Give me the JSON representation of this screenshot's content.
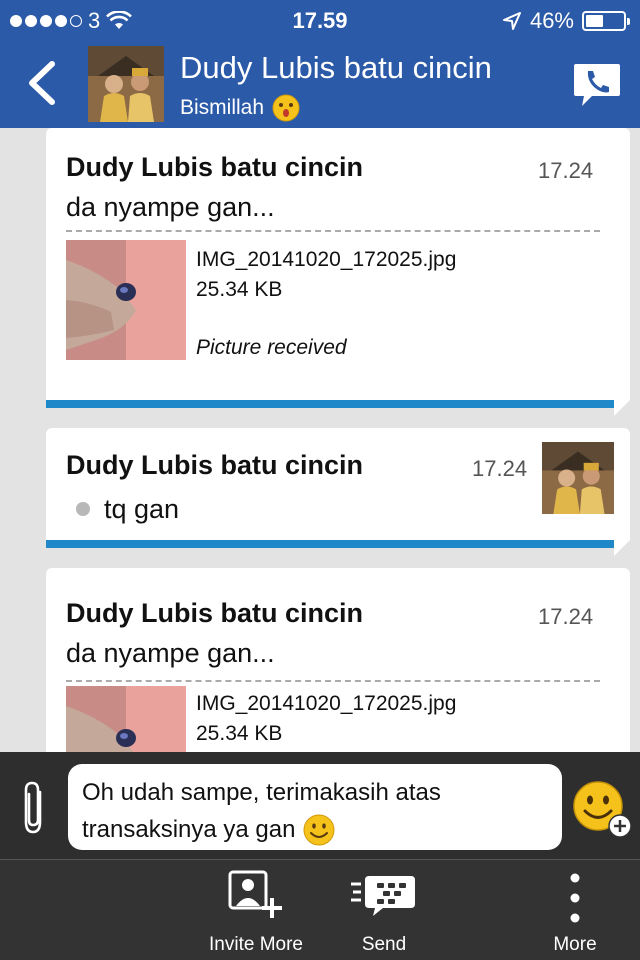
{
  "status_bar": {
    "carrier": "3",
    "time": "17.59",
    "battery": "46%",
    "battery_level": 0.46
  },
  "header": {
    "name": "Dudy Lubis batu cincin",
    "status": "Bismillah"
  },
  "messages": [
    {
      "sender": "Dudy Lubis batu cincin",
      "time": "17.24",
      "text": "da nyampe gan...",
      "file_name": "IMG_20141020_172025.jpg",
      "file_size": "25.34 KB",
      "file_status": "Picture received"
    },
    {
      "sender": "Dudy Lubis batu cincin",
      "time": "17.24",
      "text": "tq gan"
    },
    {
      "sender": "Dudy Lubis batu cincin",
      "time": "17.24",
      "text": "da nyampe gan...",
      "file_name": "IMG_20141020_172025.jpg",
      "file_size": "25.34 KB"
    }
  ],
  "composer": {
    "line1": "Oh udah sampe, terimakasih atas",
    "line2": "transaksinya ya gan"
  },
  "toolbar": {
    "invite_label": "Invite More",
    "send_label": "Send",
    "more_label": "More"
  },
  "colors": {
    "header_bg": "#2b5aa8",
    "accent_bar": "#1e88c8",
    "toolbar_bg": "#333333"
  }
}
